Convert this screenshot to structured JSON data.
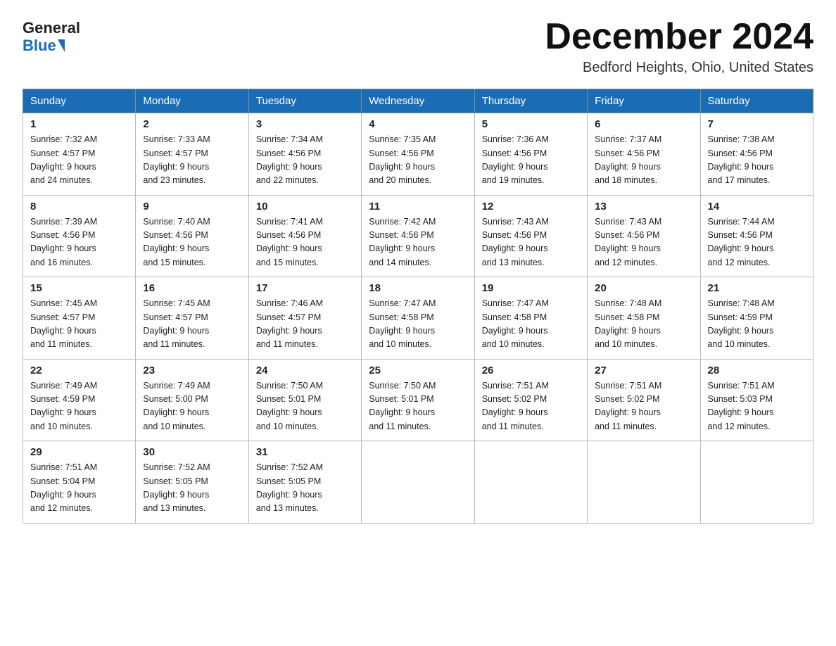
{
  "header": {
    "logo_general": "General",
    "logo_blue": "Blue",
    "title": "December 2024",
    "location": "Bedford Heights, Ohio, United States"
  },
  "weekdays": [
    "Sunday",
    "Monday",
    "Tuesday",
    "Wednesday",
    "Thursday",
    "Friday",
    "Saturday"
  ],
  "weeks": [
    [
      {
        "day": "1",
        "sunrise": "7:32 AM",
        "sunset": "4:57 PM",
        "daylight": "9 hours and 24 minutes."
      },
      {
        "day": "2",
        "sunrise": "7:33 AM",
        "sunset": "4:57 PM",
        "daylight": "9 hours and 23 minutes."
      },
      {
        "day": "3",
        "sunrise": "7:34 AM",
        "sunset": "4:56 PM",
        "daylight": "9 hours and 22 minutes."
      },
      {
        "day": "4",
        "sunrise": "7:35 AM",
        "sunset": "4:56 PM",
        "daylight": "9 hours and 20 minutes."
      },
      {
        "day": "5",
        "sunrise": "7:36 AM",
        "sunset": "4:56 PM",
        "daylight": "9 hours and 19 minutes."
      },
      {
        "day": "6",
        "sunrise": "7:37 AM",
        "sunset": "4:56 PM",
        "daylight": "9 hours and 18 minutes."
      },
      {
        "day": "7",
        "sunrise": "7:38 AM",
        "sunset": "4:56 PM",
        "daylight": "9 hours and 17 minutes."
      }
    ],
    [
      {
        "day": "8",
        "sunrise": "7:39 AM",
        "sunset": "4:56 PM",
        "daylight": "9 hours and 16 minutes."
      },
      {
        "day": "9",
        "sunrise": "7:40 AM",
        "sunset": "4:56 PM",
        "daylight": "9 hours and 15 minutes."
      },
      {
        "day": "10",
        "sunrise": "7:41 AM",
        "sunset": "4:56 PM",
        "daylight": "9 hours and 15 minutes."
      },
      {
        "day": "11",
        "sunrise": "7:42 AM",
        "sunset": "4:56 PM",
        "daylight": "9 hours and 14 minutes."
      },
      {
        "day": "12",
        "sunrise": "7:43 AM",
        "sunset": "4:56 PM",
        "daylight": "9 hours and 13 minutes."
      },
      {
        "day": "13",
        "sunrise": "7:43 AM",
        "sunset": "4:56 PM",
        "daylight": "9 hours and 12 minutes."
      },
      {
        "day": "14",
        "sunrise": "7:44 AM",
        "sunset": "4:56 PM",
        "daylight": "9 hours and 12 minutes."
      }
    ],
    [
      {
        "day": "15",
        "sunrise": "7:45 AM",
        "sunset": "4:57 PM",
        "daylight": "9 hours and 11 minutes."
      },
      {
        "day": "16",
        "sunrise": "7:45 AM",
        "sunset": "4:57 PM",
        "daylight": "9 hours and 11 minutes."
      },
      {
        "day": "17",
        "sunrise": "7:46 AM",
        "sunset": "4:57 PM",
        "daylight": "9 hours and 11 minutes."
      },
      {
        "day": "18",
        "sunrise": "7:47 AM",
        "sunset": "4:58 PM",
        "daylight": "9 hours and 10 minutes."
      },
      {
        "day": "19",
        "sunrise": "7:47 AM",
        "sunset": "4:58 PM",
        "daylight": "9 hours and 10 minutes."
      },
      {
        "day": "20",
        "sunrise": "7:48 AM",
        "sunset": "4:58 PM",
        "daylight": "9 hours and 10 minutes."
      },
      {
        "day": "21",
        "sunrise": "7:48 AM",
        "sunset": "4:59 PM",
        "daylight": "9 hours and 10 minutes."
      }
    ],
    [
      {
        "day": "22",
        "sunrise": "7:49 AM",
        "sunset": "4:59 PM",
        "daylight": "9 hours and 10 minutes."
      },
      {
        "day": "23",
        "sunrise": "7:49 AM",
        "sunset": "5:00 PM",
        "daylight": "9 hours and 10 minutes."
      },
      {
        "day": "24",
        "sunrise": "7:50 AM",
        "sunset": "5:01 PM",
        "daylight": "9 hours and 10 minutes."
      },
      {
        "day": "25",
        "sunrise": "7:50 AM",
        "sunset": "5:01 PM",
        "daylight": "9 hours and 11 minutes."
      },
      {
        "day": "26",
        "sunrise": "7:51 AM",
        "sunset": "5:02 PM",
        "daylight": "9 hours and 11 minutes."
      },
      {
        "day": "27",
        "sunrise": "7:51 AM",
        "sunset": "5:02 PM",
        "daylight": "9 hours and 11 minutes."
      },
      {
        "day": "28",
        "sunrise": "7:51 AM",
        "sunset": "5:03 PM",
        "daylight": "9 hours and 12 minutes."
      }
    ],
    [
      {
        "day": "29",
        "sunrise": "7:51 AM",
        "sunset": "5:04 PM",
        "daylight": "9 hours and 12 minutes."
      },
      {
        "day": "30",
        "sunrise": "7:52 AM",
        "sunset": "5:05 PM",
        "daylight": "9 hours and 13 minutes."
      },
      {
        "day": "31",
        "sunrise": "7:52 AM",
        "sunset": "5:05 PM",
        "daylight": "9 hours and 13 minutes."
      },
      null,
      null,
      null,
      null
    ]
  ],
  "labels": {
    "sunrise": "Sunrise:",
    "sunset": "Sunset:",
    "daylight": "Daylight:"
  }
}
